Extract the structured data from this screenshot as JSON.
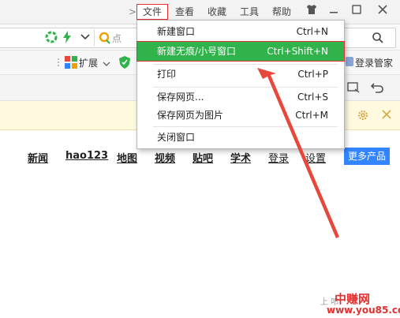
{
  "menubar": {
    "chevron": ">",
    "items": [
      "文件",
      "查看",
      "收藏",
      "工具",
      "帮助"
    ],
    "active_index": 0
  },
  "addressbar": {
    "search_placeholder": "点"
  },
  "toolbar": {
    "extensions_label": "扩展",
    "login_label": "登录管家"
  },
  "file_menu": {
    "items": [
      {
        "label": "新建窗口",
        "shortcut": "Ctrl+N"
      },
      {
        "label": "新建无痕/小号窗口",
        "shortcut": "Ctrl+Shift+N",
        "highlighted": true
      },
      {
        "label": "打印",
        "shortcut": "Ctrl+P"
      },
      {
        "label": "保存网页...",
        "shortcut": "Ctrl+S"
      },
      {
        "label": "保存网页为图片",
        "shortcut": "Ctrl+M"
      },
      {
        "label": "关闭窗口",
        "shortcut": ""
      }
    ]
  },
  "page": {
    "nav_links": [
      "新闻",
      "hao123",
      "地图",
      "视频",
      "贴吧",
      "学术",
      "登录",
      "设置"
    ],
    "more_products": "更多产品"
  },
  "watermark": {
    "brand": "中赚网",
    "url": "www.you85.com",
    "sub": "上 叩"
  },
  "colors": {
    "highlight_green": "#2fb34a",
    "annotation_red": "#e03030",
    "link_blue": "#3385ff",
    "notify_bg": "#fff9e0"
  }
}
